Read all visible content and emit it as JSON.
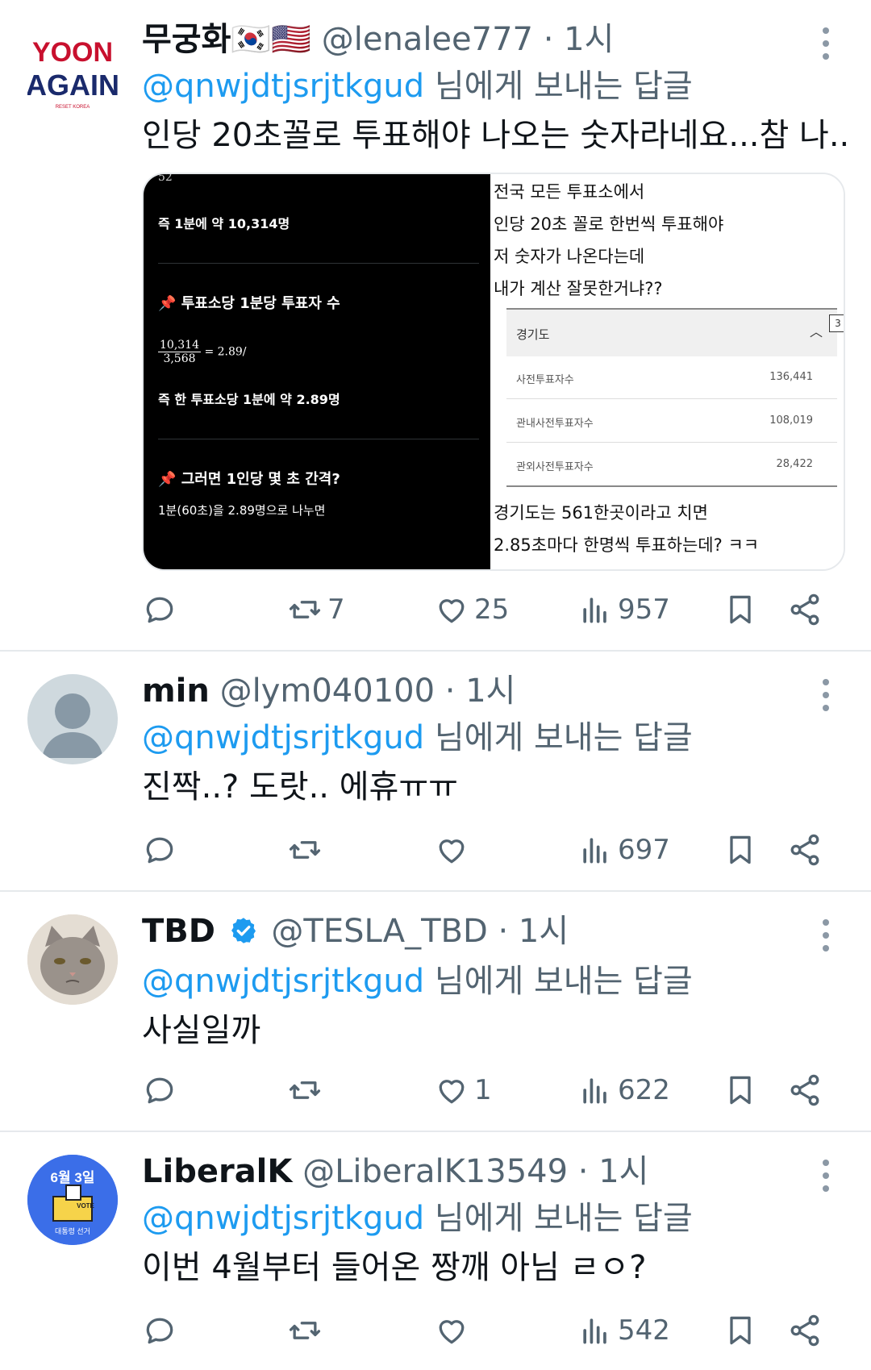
{
  "tweets": [
    {
      "name": "무궁화🇰🇷🇺🇸",
      "handle": "@lenalee777",
      "time": "· 1시",
      "avatar_text_top": "YOON",
      "avatar_text_bottom": "AGAIN",
      "avatar_text_small": "RESET KOREA",
      "reply_mention": "@qnwjdtjsrjtkgud",
      "reply_suffix": " 님에게 보내는 답글",
      "text": "인당 20초꼴로 투표해야 나오는 숫자라네요...참 나..",
      "replies": "",
      "retweets": "7",
      "likes": "25",
      "views": "957",
      "media": {
        "left": {
          "top_cut": "52",
          "line1": "즉 1분에 약 10,314명",
          "heading1": "투표소당 1분당 투표자 수",
          "frac_num": "10,314",
          "frac_den": "3,568",
          "frac_eq": "= 2.89/",
          "line2": "즉 한 투표소당 1분에 약 2.89명",
          "heading2": "그러면 1인당 몇 초 간격?",
          "line3": "1분(60초)을 2.89명으로 나누면"
        },
        "right": {
          "l1": "전국 모든 투표소에서",
          "l2": "인당 20초 꼴로 한번씩 투표해야",
          "l3": "저 숫자가 나온다는데",
          "l4": "내가 계산 잘못한거냐??",
          "region": "경기도",
          "badge": "3",
          "rows": [
            {
              "label": "사전투표자수",
              "value": "136,441"
            },
            {
              "label": "관내사전투표자수",
              "value": "108,019"
            },
            {
              "label": "관외사전투표자수",
              "value": "28,422"
            }
          ],
          "l5": "경기도는 561한곳이라고 치면",
          "l6": "2.85초마다 한명씩 투표하는데? ㅋㅋ"
        }
      }
    },
    {
      "name": "min",
      "handle": "@lym040100",
      "time": "· 1시",
      "reply_mention": "@qnwjdtjsrjtkgud",
      "reply_suffix": " 님에게 보내는 답글",
      "text": "진짝..? 도랏.. 에휴ㅠㅠ",
      "views": "697"
    },
    {
      "name": "TBD",
      "handle": "@TESLA_TBD",
      "time": "· 1시",
      "reply_mention": "@qnwjdtjsrjtkgud",
      "reply_suffix": " 님에게 보내는 답글",
      "text": "사실일까",
      "likes": "1",
      "views": "622"
    },
    {
      "name": "LiberalK",
      "handle": "@LiberalK13549",
      "time": "· 1시",
      "avatar_text": "6월 3일",
      "avatar_small": "대통령 선거",
      "avatar_vote": "VOTE",
      "reply_mention": "@qnwjdtjsrjtkgud",
      "reply_suffix": " 님에게 보내는 답글",
      "text": "이번 4월부터 들어온 짱깨 아님 ㄹㅇ?",
      "views": "542"
    }
  ],
  "colors": {
    "accent": "#1d9bf0",
    "secondary_text": "#536471",
    "divider": "#e6e9ec"
  },
  "icons": [
    "reply-icon",
    "retweet-icon",
    "like-icon",
    "views-icon",
    "bookmark-icon",
    "share-icon",
    "more-icon",
    "verified-badge-icon"
  ]
}
